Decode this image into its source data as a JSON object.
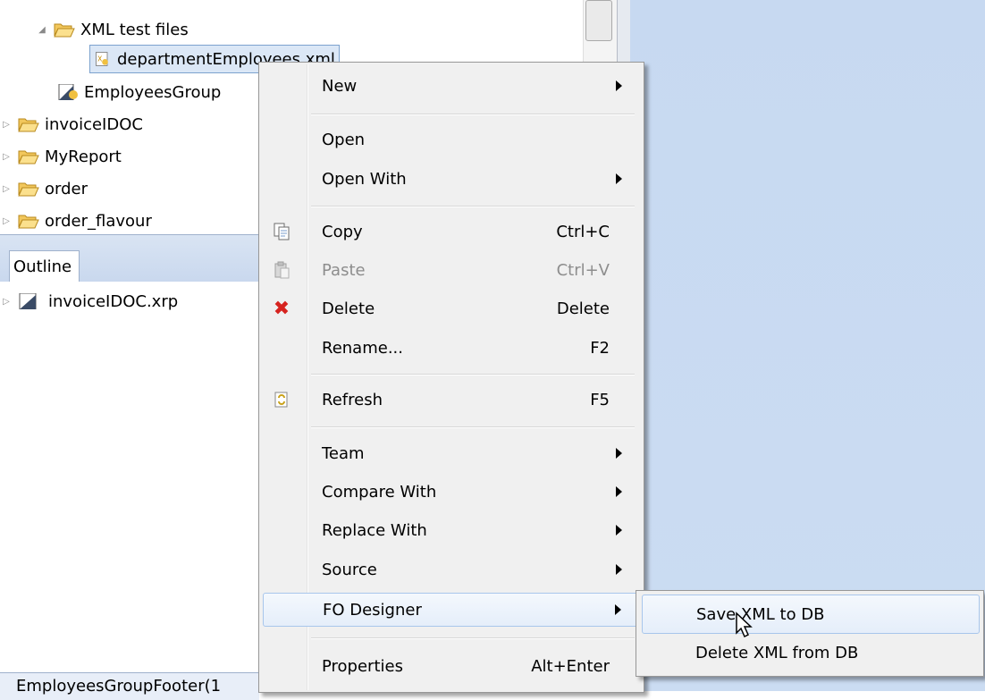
{
  "tree": {
    "items": [
      {
        "label": "XML test files",
        "twisty": "◢",
        "icon": "folder-open-icon"
      },
      {
        "label": "departmentEmployees.xml",
        "icon": "xml-file-icon"
      },
      {
        "label": "EmployeesGroup",
        "icon": "report-file-icon"
      },
      {
        "label": "invoiceIDOC",
        "twisty": "▷",
        "icon": "folder-icon"
      },
      {
        "label": "MyReport",
        "twisty": "▷",
        "icon": "folder-icon"
      },
      {
        "label": "order",
        "twisty": "▷",
        "icon": "folder-icon"
      },
      {
        "label": "order_flavour",
        "twisty": "▷",
        "icon": "folder-icon"
      }
    ]
  },
  "outline": {
    "tab_label": "Outline",
    "items": [
      {
        "label": "invoiceIDOC.xrp",
        "twisty": "▷",
        "icon": "report-file-icon"
      }
    ]
  },
  "bottom_tab": {
    "label": "EmployeesGroupFooter(1"
  },
  "context_menu": {
    "items": [
      {
        "label": "New",
        "submenu": true
      },
      {
        "label": "Open"
      },
      {
        "label": "Open With",
        "submenu": true
      },
      {
        "label": "Copy",
        "accel": "Ctrl+C",
        "icon": "copy-icon"
      },
      {
        "label": "Paste",
        "accel": "Ctrl+V",
        "icon": "paste-icon",
        "disabled": true
      },
      {
        "label": "Delete",
        "accel": "Delete",
        "icon": "delete-icon"
      },
      {
        "label": "Rename...",
        "accel": "F2"
      },
      {
        "label": "Refresh",
        "accel": "F5",
        "icon": "refresh-icon"
      },
      {
        "label": "Team",
        "submenu": true
      },
      {
        "label": "Compare With",
        "submenu": true
      },
      {
        "label": "Replace With",
        "submenu": true
      },
      {
        "label": "Source",
        "submenu": true
      },
      {
        "label": "FO Designer",
        "submenu": true,
        "highlighted": true
      },
      {
        "label": "Properties",
        "accel": "Alt+Enter"
      }
    ]
  },
  "fo_submenu": {
    "items": [
      {
        "label": "Save XML to DB",
        "highlighted": true
      },
      {
        "label": "Delete XML from DB"
      }
    ]
  },
  "colors": {
    "accent": "#a8c6ec",
    "editor_bg": "#c7d9f1",
    "delete_red": "#d6231f"
  }
}
